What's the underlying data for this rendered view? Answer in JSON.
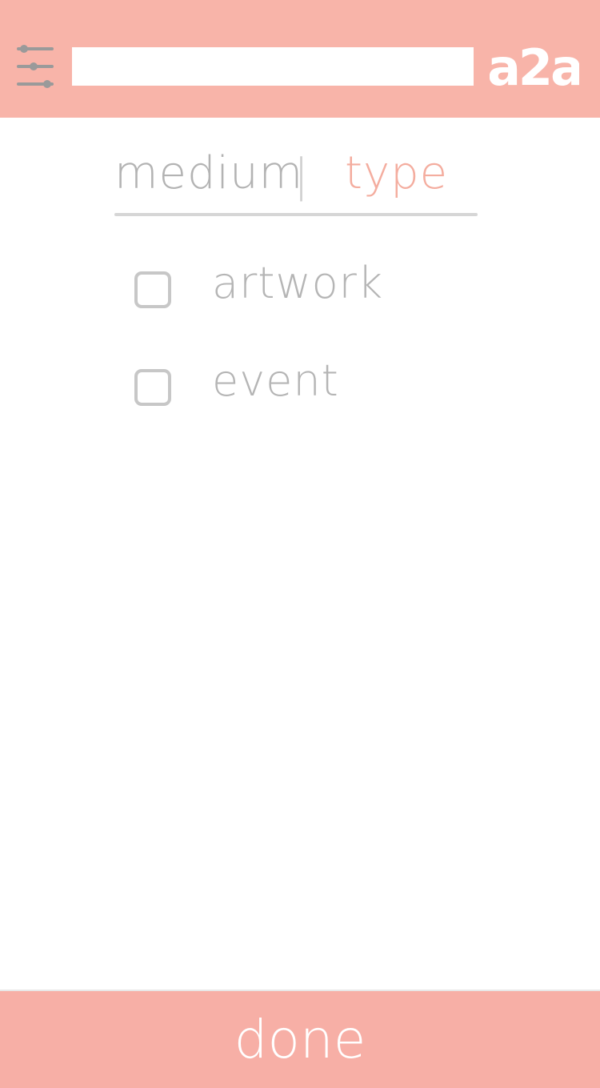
{
  "header": {
    "filter_icon": "sliders-icon",
    "search": {
      "value": "",
      "placeholder": ""
    },
    "logo_text": "a2a",
    "background_color": "#f8b4a9"
  },
  "tabs": {
    "items": [
      {
        "label": "medium",
        "active": false
      },
      {
        "label": "type",
        "active": true
      }
    ],
    "separator": "|",
    "active_color": "#f4ad9f",
    "inactive_color": "#b3b3b3"
  },
  "options": [
    {
      "label": "artwork",
      "checked": false
    },
    {
      "label": "event",
      "checked": false
    }
  ],
  "footer": {
    "done_label": "done",
    "background_color": "#f7afa6"
  }
}
